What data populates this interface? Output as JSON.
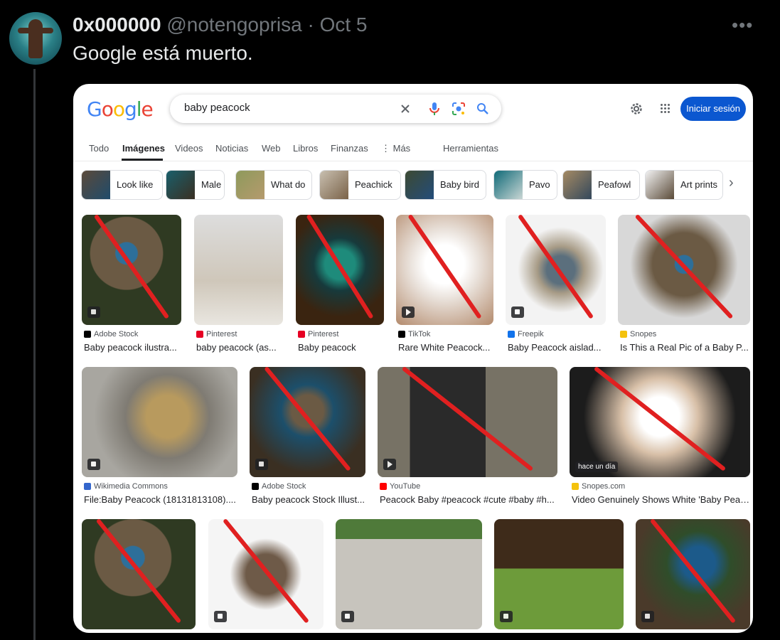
{
  "tweet": {
    "display_name": "0x000000",
    "handle": "@notengoprisa",
    "separator": "·",
    "date": "Oct 5",
    "text": "Google está muerto.",
    "more_icon": "more-horizontal-icon"
  },
  "google": {
    "logo": "Google",
    "colors": {
      "blue": "#4285f4",
      "red": "#ea4335",
      "yellow": "#fbbc05",
      "green": "#34a853",
      "signin": "#0b57d0"
    },
    "search_value": "baby peacock",
    "signin_label": "Iniciar sesión",
    "tabs": [
      {
        "label": "Todo"
      },
      {
        "label": "Imágenes",
        "active": true
      },
      {
        "label": "Videos"
      },
      {
        "label": "Noticias"
      },
      {
        "label": "Web"
      },
      {
        "label": "Libros"
      },
      {
        "label": "Finanzas"
      },
      {
        "label": "⋮ Más"
      },
      {
        "label": "Herramientas"
      }
    ],
    "chips": [
      {
        "label": "Look like"
      },
      {
        "label": "Male"
      },
      {
        "label": "What do"
      },
      {
        "label": "Peachick"
      },
      {
        "label": "Baby bird"
      },
      {
        "label": "Pavo"
      },
      {
        "label": "Peafowl"
      },
      {
        "label": "Art prints"
      }
    ],
    "results": [
      {
        "source": "Adobe Stock",
        "title": "Baby peacock ilustra...",
        "crossed": true,
        "badge": "image"
      },
      {
        "source": "Pinterest",
        "title": "baby peacock (as...",
        "crossed": false,
        "badge": ""
      },
      {
        "source": "Pinterest",
        "title": "Baby peacock",
        "crossed": true,
        "badge": ""
      },
      {
        "source": "TikTok",
        "title": "Rare White Peacock...",
        "crossed": true,
        "badge": "video"
      },
      {
        "source": "Freepik",
        "title": "Baby Peacock aislad...",
        "crossed": true,
        "badge": "image"
      },
      {
        "source": "Snopes",
        "title": "Is This a Real Pic of a Baby P...",
        "crossed": true,
        "badge": ""
      },
      {
        "source": "Wikimedia Commons",
        "title": "File:Baby Peacock (18131813108)....",
        "crossed": false,
        "badge": "image"
      },
      {
        "source": "Adobe Stock",
        "title": "Baby peacock Stock Illust...",
        "crossed": true,
        "badge": "image"
      },
      {
        "source": "YouTube",
        "title": "Peacock Baby #peacock #cute #baby #h...",
        "crossed": true,
        "badge": "video"
      },
      {
        "source": "Snopes.com",
        "title": "Video Genuinely Shows White 'Baby Peac...",
        "crossed": true,
        "badge": "",
        "time": "hace un día"
      },
      {
        "crossed": true,
        "badge": ""
      },
      {
        "crossed": true,
        "badge": "image"
      },
      {
        "crossed": false,
        "badge": "image"
      },
      {
        "crossed": false,
        "badge": "image"
      },
      {
        "crossed": true,
        "badge": "image"
      }
    ]
  }
}
